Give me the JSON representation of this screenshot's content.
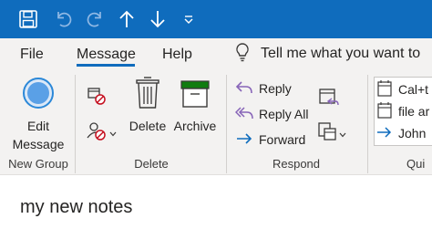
{
  "qat": {
    "icons": [
      "save-icon",
      "undo-icon",
      "redo-icon",
      "up-arrow-icon",
      "down-arrow-icon",
      "customize-qat-icon"
    ]
  },
  "tabs": {
    "file": "File",
    "message": "Message",
    "help": "Help"
  },
  "tellme": {
    "text": "Tell me what you want to",
    "icon": "lightbulb-icon"
  },
  "ribbon": {
    "new_group": {
      "label": "New Group",
      "edit_message": {
        "line1": "Edit",
        "line2": "Message"
      }
    },
    "delete_group": {
      "label": "Delete",
      "delete_button": "Delete",
      "archive_button": "Archive"
    },
    "respond_group": {
      "label": "Respond",
      "reply": "Reply",
      "reply_all": "Reply All",
      "forward": "Forward"
    },
    "quick_group": {
      "label": "Qui",
      "items": [
        "Cal+t",
        "file ar",
        "John"
      ]
    }
  },
  "body": {
    "text": "my new notes"
  },
  "colors": {
    "titlebar": "#0f6cbd",
    "ribbon_bg": "#f3f2f1",
    "accent_purple": "#8764b8",
    "accent_blue": "#0f6cbd",
    "delete_red": "#c50f1f",
    "archive_green": "#107c10"
  }
}
